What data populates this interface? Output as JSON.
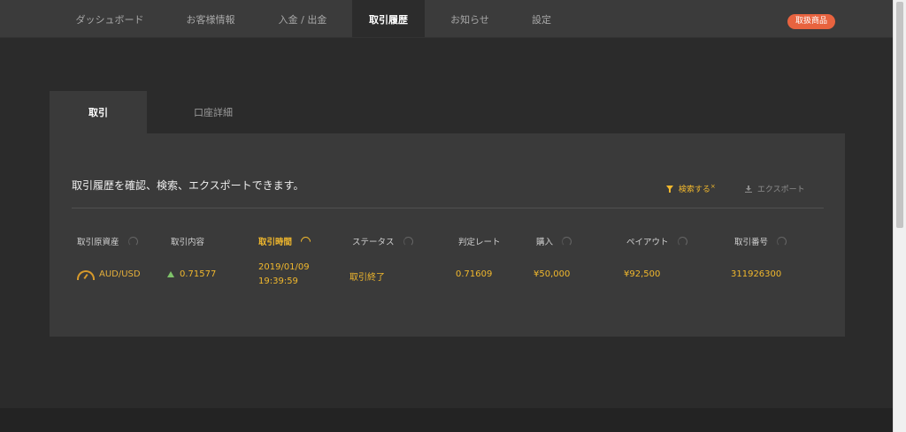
{
  "nav": {
    "items": [
      {
        "label": "ダッシュボード"
      },
      {
        "label": "お客様情報"
      },
      {
        "label": "入金 / 出金"
      },
      {
        "label": "取引履歴"
      },
      {
        "label": "お知らせ"
      },
      {
        "label": "設定"
      }
    ],
    "active_index": 3,
    "badge": "取扱商品"
  },
  "tabs": [
    {
      "label": "取引"
    },
    {
      "label": "口座詳細"
    }
  ],
  "panel": {
    "description": "取引履歴を確認、検索、エクスポートできます。",
    "search_label": "検索する",
    "search_clear": "×",
    "export_label": "エクスポート"
  },
  "table": {
    "headers": [
      "取引原資産",
      "取引内容",
      "取引時間",
      "ステータス",
      "判定レート",
      "購入",
      "ペイアウト",
      "取引番号"
    ],
    "sorted_column": "取引時間",
    "rows": [
      {
        "asset": "AUD/USD",
        "content": "0.71577",
        "time_date": "2019/01/09",
        "time_clock": "19:39:59",
        "status": "取引終了",
        "rate": "0.71609",
        "purchase": "¥50,000",
        "payout": "¥92,500",
        "trade_no": "311926300"
      }
    ]
  },
  "colors": {
    "accent": "#f1b82d",
    "badge": "#e8633f",
    "up": "#7fc36a"
  }
}
